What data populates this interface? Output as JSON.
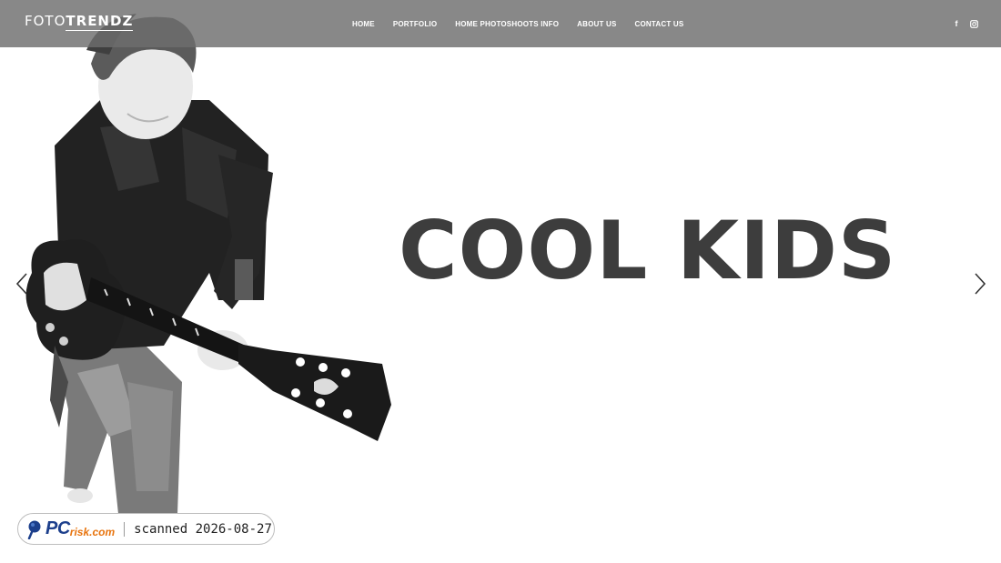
{
  "header": {
    "logo_light": "FOTO",
    "logo_bold": "TRENDZ",
    "nav": [
      {
        "label": "HOME"
      },
      {
        "label": "PORTFOLIO"
      },
      {
        "label": "HOME PHOTOSHOOTS INFO"
      },
      {
        "label": "ABOUT US"
      },
      {
        "label": "CONTACT US"
      }
    ],
    "social": {
      "facebook_icon": "facebook-icon",
      "facebook_glyph": "f",
      "instagram_icon": "instagram-icon"
    }
  },
  "hero": {
    "headline": "COOL KIDS",
    "image": "boy-with-guitar-photo",
    "prev_icon": "chevron-left-icon",
    "next_icon": "chevron-right-icon"
  },
  "badge": {
    "brand_pc": "PC",
    "brand_risk": "risk.com",
    "text": "scanned 2026-08-27"
  },
  "colors": {
    "header_bg": "#6e6e6e",
    "headline": "#3d3d3d",
    "badge_blue": "#1c3f8c",
    "badge_orange": "#e8740e"
  }
}
